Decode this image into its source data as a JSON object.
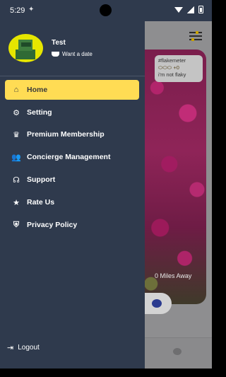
{
  "status_bar": {
    "time": "5:29"
  },
  "profile": {
    "name": "Test",
    "status": "Want a date"
  },
  "menu": [
    {
      "label": "Home",
      "icon": "home-icon",
      "active": true
    },
    {
      "label": "Setting",
      "icon": "gear-icon",
      "active": false
    },
    {
      "label": "Premium Membership",
      "icon": "crown-icon",
      "active": false
    },
    {
      "label": "Concierge Management",
      "icon": "users-icon",
      "active": false
    },
    {
      "label": "Support",
      "icon": "headset-icon",
      "active": false
    },
    {
      "label": "Rate Us",
      "icon": "star-icon",
      "active": false
    },
    {
      "label": "Privacy Policy",
      "icon": "shield-icon",
      "active": false
    }
  ],
  "logout": {
    "label": "Logout"
  },
  "background_card": {
    "flake_tag": "#flakemeter",
    "flake_value": "+0",
    "flake_caption": "i'm not flaky",
    "distance": "0 Miles Away"
  },
  "colors": {
    "drawer_bg": "#2f3a4d",
    "active_bg": "#ffdc54"
  }
}
